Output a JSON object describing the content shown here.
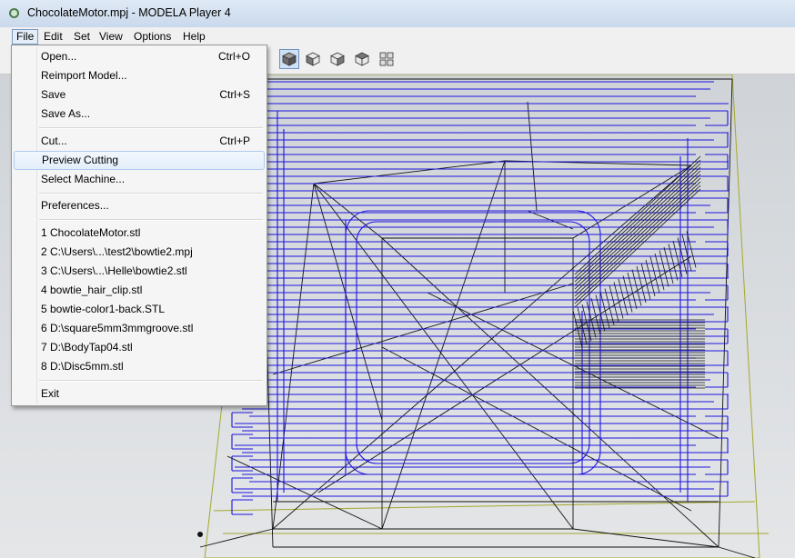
{
  "window": {
    "title": "ChocolateMotor.mpj - MODELA Player 4"
  },
  "menubar": {
    "items": [
      {
        "label": "File"
      },
      {
        "label": "Edit"
      },
      {
        "label": "Set"
      },
      {
        "label": "View"
      },
      {
        "label": "Options"
      },
      {
        "label": "Help"
      }
    ]
  },
  "file_menu": {
    "items": [
      {
        "label": "Open...",
        "shortcut": "Ctrl+O"
      },
      {
        "label": "Reimport Model...",
        "shortcut": ""
      },
      {
        "label": "Save",
        "shortcut": "Ctrl+S"
      },
      {
        "label": "Save As...",
        "shortcut": ""
      },
      {
        "label": "Cut...",
        "shortcut": "Ctrl+P"
      },
      {
        "label": "Preview Cutting",
        "shortcut": "",
        "highlighted": true
      },
      {
        "label": "Select Machine...",
        "shortcut": ""
      },
      {
        "label": "Preferences...",
        "shortcut": ""
      },
      {
        "label": "1 ChocolateMotor.stl"
      },
      {
        "label": "2 C:\\Users\\...\\test2\\bowtie2.mpj"
      },
      {
        "label": "3 C:\\Users\\...\\Helle\\bowtie2.stl"
      },
      {
        "label": "4 bowtie_hair_clip.stl"
      },
      {
        "label": "5 bowtie-color1-back.STL"
      },
      {
        "label": "6 D:\\square5mm3mmgroove.stl"
      },
      {
        "label": "7 D:\\BodyTap04.stl"
      },
      {
        "label": "8 D:\\Disc5mm.stl"
      },
      {
        "label": "Exit"
      }
    ]
  },
  "toolbar": {
    "view_buttons": [
      "iso-view-icon",
      "front-view-icon",
      "right-view-icon",
      "left-view-icon",
      "multi-view-icon"
    ]
  },
  "colors": {
    "toolpath": "#1d14e0",
    "wireframe": "#111111",
    "bounding_box": "#a3a82c",
    "highlight": "#e3eefa"
  }
}
